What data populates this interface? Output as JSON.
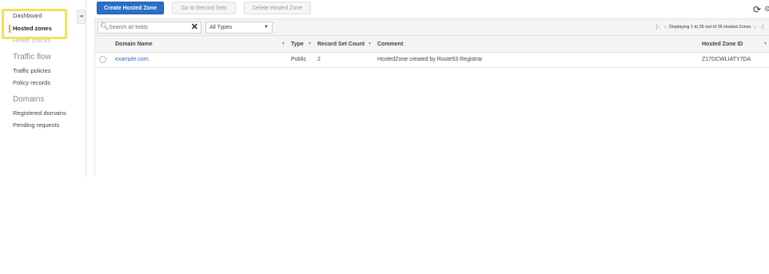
{
  "sidebar": {
    "dashboard": "Dashboard",
    "hosted_zones": "Hosted zones",
    "health_checks": "Health checks",
    "traffic_flow_heading": "Traffic flow",
    "traffic_policies": "Traffic policies",
    "policy_records": "Policy records",
    "domains_heading": "Domains",
    "registered_domains": "Registered domains",
    "pending_requests": "Pending requests",
    "collapse_glyph": "◂"
  },
  "toolbar": {
    "create_label": "Create Hosted Zone",
    "goto_label": "Go to Record Sets",
    "delete_label": "Delete Hosted Zone",
    "refresh_icon": "⟳"
  },
  "filter": {
    "search_placeholder": "Search all fields",
    "clear_glyph": "✕",
    "type_selected": "All Types"
  },
  "pagination": {
    "text": "Displaying 1 to 35 out of 35 Hosted Zones"
  },
  "table": {
    "headers": {
      "domain_name": "Domain Name",
      "type": "Type",
      "record_set_count": "Record Set Count",
      "comment": "Comment",
      "hosted_zone_id": "Hosted Zone ID"
    },
    "rows": [
      {
        "domain_name": "example.com.",
        "type": "Public",
        "record_set_count": "2",
        "comment": "HostedZone created by Route53 Registrar",
        "hosted_zone_id": "Z17DCWLIATY7DA"
      }
    ]
  },
  "colors": {
    "primary": "#2a6fc7",
    "highlight": "#f2e15a",
    "active": "#f0a020"
  }
}
